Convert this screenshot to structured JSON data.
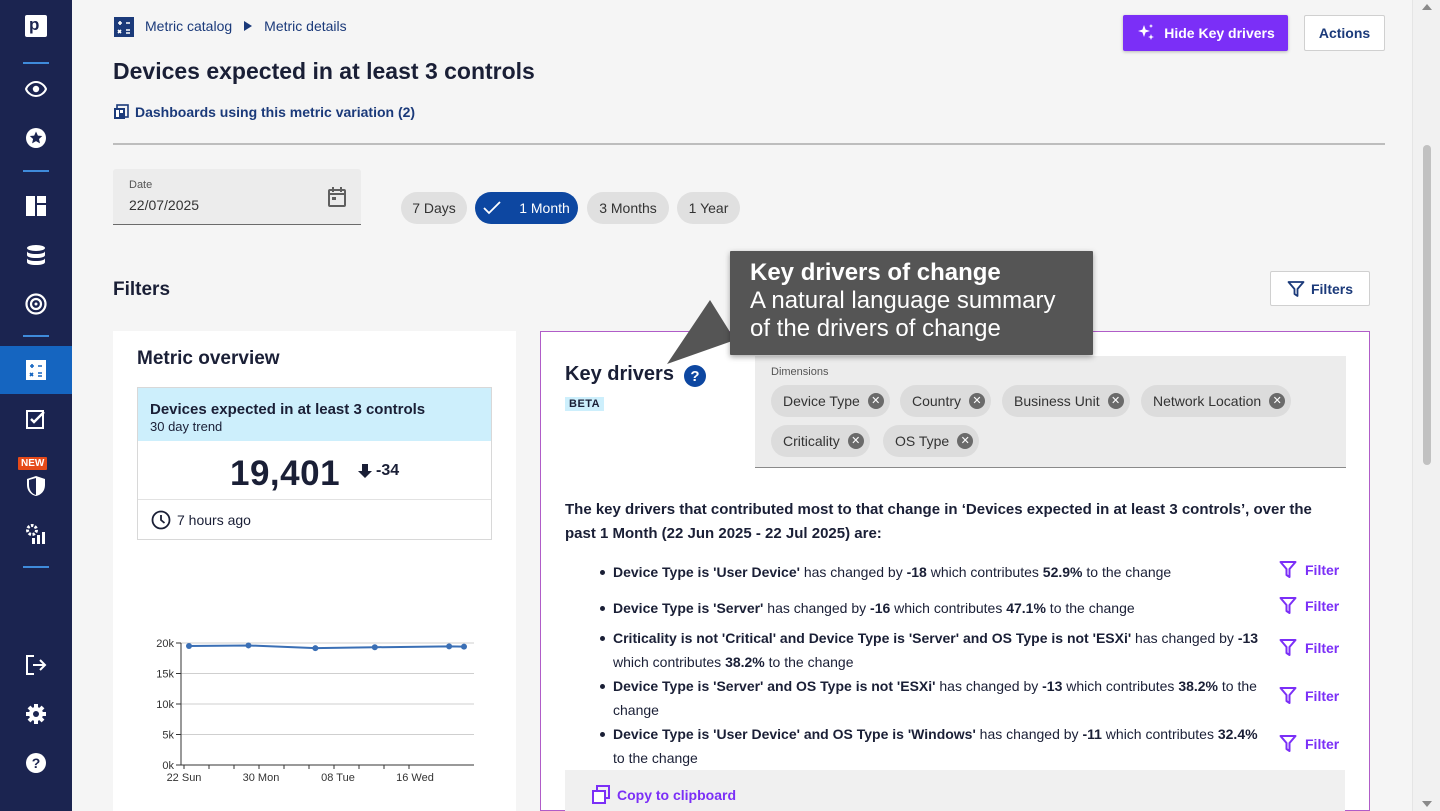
{
  "nav": {
    "logo_letter": "p",
    "new_badge": "NEW",
    "items": [
      {
        "name": "eye-icon"
      },
      {
        "name": "star-icon"
      },
      {
        "name": "dashboard-icon"
      },
      {
        "name": "database-icon"
      },
      {
        "name": "target-icon"
      },
      {
        "name": "metrics-icon"
      },
      {
        "name": "checklist-icon"
      },
      {
        "name": "shield-icon"
      },
      {
        "name": "controls-icon"
      },
      {
        "name": "logout-icon"
      },
      {
        "name": "settings-icon"
      },
      {
        "name": "help-icon"
      }
    ]
  },
  "breadcrumb": {
    "root": "Metric catalog",
    "current": "Metric details"
  },
  "page": {
    "title": "Devices expected in at least 3 controls",
    "dashboards_link": "Dashboards using this metric variation (2)"
  },
  "header_buttons": {
    "hide_key_drivers": "Hide Key drivers",
    "actions": "Actions"
  },
  "date": {
    "label": "Date",
    "value": "22/07/2025"
  },
  "ranges": {
    "seven_days": "7 Days",
    "one_month": "1 Month",
    "three_months": "3 Months",
    "one_year": "1 Year",
    "selected": "1 Month"
  },
  "filters": {
    "title": "Filters",
    "button": "Filters"
  },
  "overview": {
    "title": "Metric overview",
    "card_title": "Devices expected in at least 3 controls",
    "card_subtitle": "30 day trend",
    "value": "19,401",
    "delta": "-34",
    "updated": "7 hours ago"
  },
  "chart_data": {
    "type": "line",
    "x_tick_labels": [
      "22 Sun",
      "30 Mon",
      "08 Tue",
      "16 Wed"
    ],
    "y_tick_labels": [
      "20k",
      "15k",
      "10k",
      "5k",
      "0k"
    ],
    "ylim": [
      0,
      20000
    ],
    "series": [
      {
        "values": [
          19500,
          19600,
          19150,
          19300,
          19450,
          19401
        ]
      }
    ],
    "x_positions": [
      0,
      8,
      17,
      25,
      35,
      37
    ],
    "x_max": 37,
    "line_color": "#3a6fb5"
  },
  "key_drivers": {
    "title": "Key drivers",
    "beta": "BETA",
    "help_glyph": "?",
    "dimensions_label": "Dimensions",
    "dimensions": [
      "Device Type",
      "Country",
      "Business Unit",
      "Network Location",
      "Criticality",
      "OS Type"
    ],
    "summary": "The key drivers that contributed most to that change in ‘Devices expected in at least 3 controls’, over the past 1 Month (22 Jun 2025 - 22 Jul 2025) are:",
    "items": [
      {
        "subject": "Device Type is 'User Device'",
        "mid": " has changed by ",
        "delta": "-18",
        "mid2": " which contributes ",
        "pct": "52.9%",
        "tail": " to the change"
      },
      {
        "subject": "Device Type is 'Server'",
        "mid": " has changed by ",
        "delta": "-16",
        "mid2": " which contributes ",
        "pct": "47.1%",
        "tail": " to the change"
      },
      {
        "subject": "Criticality is not 'Critical' and Device Type is 'Server' and OS Type is not 'ESXi'",
        "mid": " has changed by ",
        "delta": "-13",
        "mid2": " which contributes ",
        "pct": "38.2%",
        "tail": " to the change"
      },
      {
        "subject": "Device Type is 'Server' and OS Type is not 'ESXi'",
        "mid": " has changed by ",
        "delta": "-13",
        "mid2": " which contributes ",
        "pct": "38.2%",
        "tail": " to the change"
      },
      {
        "subject": "Device Type is 'User Device' and OS Type is 'Windows'",
        "mid": " has changed by ",
        "delta": "-11",
        "mid2": " which contributes ",
        "pct": "32.4%",
        "tail": " to the change"
      }
    ],
    "filter_label": "Filter",
    "copy_label": "Copy to clipboard"
  },
  "tooltip": {
    "title": "Key drivers of change",
    "body": "A natural language summary of the drivers of change"
  },
  "colors": {
    "sidebar": "#1b2450",
    "accent": "#7b2ff7",
    "primary": "#0d47a1",
    "highlight": "#cdeffc"
  }
}
